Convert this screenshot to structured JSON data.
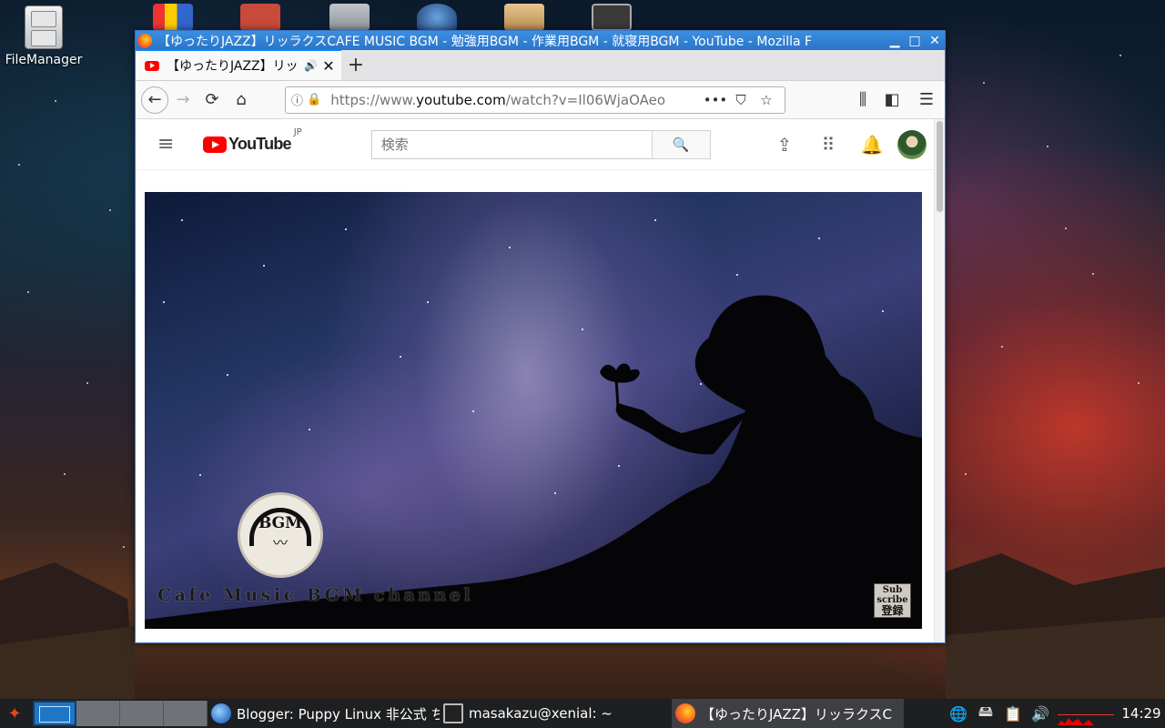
{
  "desktop": {
    "file_manager_label": "FileManager"
  },
  "window": {
    "title": "【ゆったりJAZZ】リッラクスCAFE MUSIC BGM - 勉強用BGM - 作業用BGM - 就寝用BGM - YouTube - Mozilla F",
    "minimize_glyph": "▁",
    "maximize_glyph": "□",
    "close_glyph": "✕"
  },
  "tab": {
    "title": "【ゆったりJAZZ】リッ",
    "audio_glyph": "🔊",
    "close_glyph": "✕",
    "new_tab_glyph": "+"
  },
  "navbar": {
    "url_prefix": "https://www.",
    "url_domain": "youtube.com",
    "url_path": "/watch?v=Il06WjaOAeo"
  },
  "youtube": {
    "wordmark": "YouTube",
    "region": "JP",
    "search_placeholder": "検索"
  },
  "video": {
    "badge_text": "BGM",
    "channel_name": "Cafe Music BGM channel",
    "subscribe_line1": "Sub",
    "subscribe_line2": "scribe",
    "subscribe_line3": "登録"
  },
  "taskbar": {
    "task1": "Blogger: Puppy Linux 非公式 ち",
    "task2": "masakazu@xenial: ~",
    "task3": "【ゆったりJAZZ】リッラクスC",
    "clock": "14:29"
  },
  "colors": {
    "titlebar": "#2a74c9",
    "youtube_red": "#ff0000",
    "tab_accent": "#0a84ff"
  }
}
